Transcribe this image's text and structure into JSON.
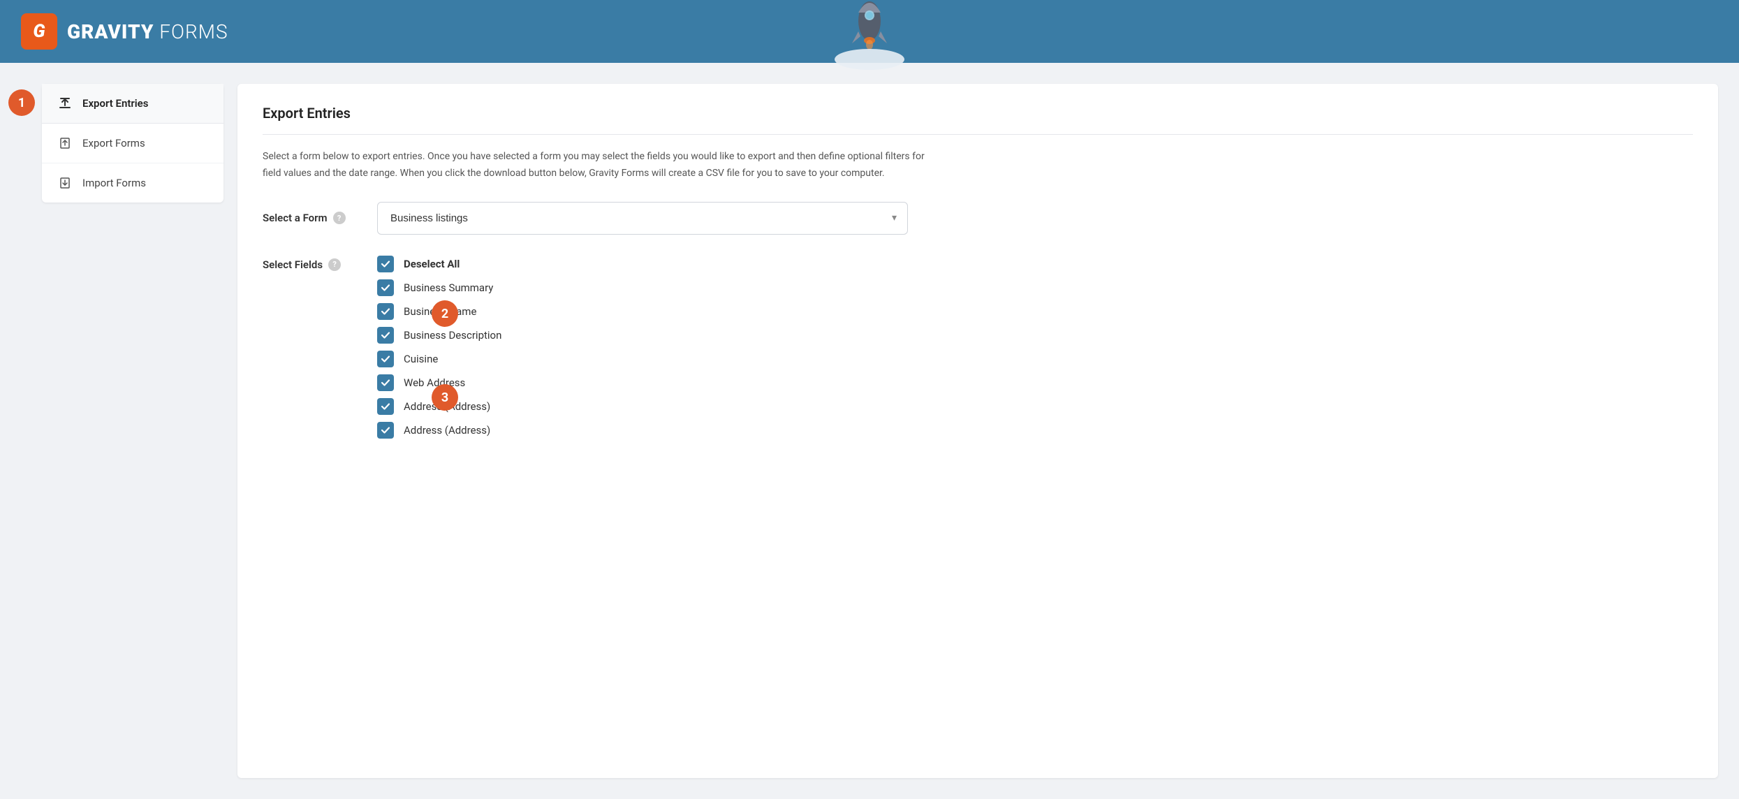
{
  "header": {
    "logo_letter": "G",
    "logo_bold": "GRAVITY",
    "logo_light": " FORMS"
  },
  "badges": {
    "badge1": "1",
    "badge2": "2",
    "badge3": "3"
  },
  "sidebar": {
    "items": [
      {
        "id": "export-entries",
        "label": "Export Entries",
        "icon": "⬆",
        "active": true
      },
      {
        "id": "export-forms",
        "label": "Export Forms",
        "icon": "⬆"
      },
      {
        "id": "import-forms",
        "label": "Import Forms",
        "icon": "⬇"
      }
    ]
  },
  "panel": {
    "title": "Export Entries",
    "description": "Select a form below to export entries. Once you have selected a form you may select the fields you would like to export and then define optional filters for field values and the date range. When you click the download button below, Gravity Forms will create a CSV file for you to save to your computer.",
    "select_form_label": "Select a Form",
    "select_form_placeholder": "Business listings",
    "select_fields_label": "Select Fields",
    "help_tooltip": "?",
    "fields": [
      {
        "id": "deselect-all",
        "label": "Deselect All",
        "bold": true,
        "checked": true
      },
      {
        "id": "business-summary",
        "label": "Business Summary",
        "bold": false,
        "checked": true
      },
      {
        "id": "business-name",
        "label": "Business Name",
        "bold": false,
        "checked": true
      },
      {
        "id": "business-description",
        "label": "Business Description",
        "bold": false,
        "checked": true
      },
      {
        "id": "cuisine",
        "label": "Cuisine",
        "bold": false,
        "checked": true
      },
      {
        "id": "web-address",
        "label": "Web Address",
        "bold": false,
        "checked": true
      },
      {
        "id": "address-1",
        "label": "Address (Address)",
        "bold": false,
        "checked": true
      },
      {
        "id": "address-2",
        "label": "Address (Address)",
        "bold": false,
        "checked": true
      }
    ]
  },
  "colors": {
    "header_bg": "#3a7ca5",
    "accent_orange": "#e8591a",
    "accent_red_badge": "#e05a2b",
    "checkbox_blue": "#3a7ca5"
  }
}
